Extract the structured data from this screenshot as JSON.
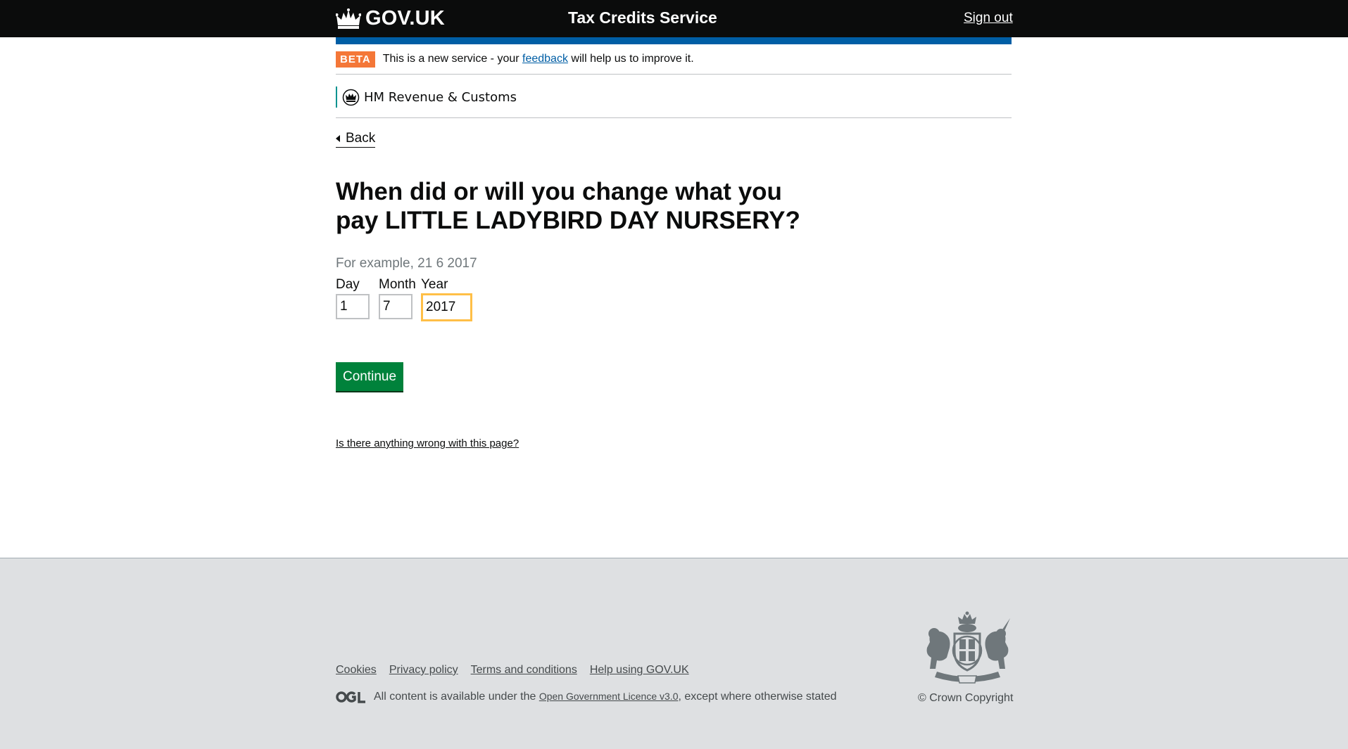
{
  "header": {
    "logo_text": "GOV.UK",
    "service_name": "Tax Credits Service",
    "sign_out": "Sign out"
  },
  "beta_banner": {
    "tag": "BETA",
    "text_before": "This is a new service - your ",
    "link": "feedback",
    "text_after": " will help us to improve it."
  },
  "organisation": {
    "name": "HM Revenue & Customs"
  },
  "back_link": "Back",
  "page": {
    "heading": "When did or will you change what you pay LITTLE LADYBIRD DAY NURSERY?",
    "hint": "For example, 21 6 2017",
    "date": {
      "day_label": "Day",
      "day_value": "1",
      "month_label": "Month",
      "month_value": "7",
      "year_label": "Year",
      "year_value": "2017"
    },
    "continue_button": "Continue",
    "report_link": "Is there anything wrong with this page?"
  },
  "footer": {
    "links": [
      "Cookies",
      "Privacy policy",
      "Terms and conditions",
      "Help using GOV.UK"
    ],
    "licence_before": "All content is available under the ",
    "licence_link": "Open Government Licence v3.0",
    "licence_after": ", except where otherwise stated",
    "copyright": "© Crown Copyright"
  },
  "colors": {
    "header_bg": "#0b0c0c",
    "blue_bar": "#005ea5",
    "beta_tag": "#f47738",
    "button": "#00823b",
    "focus": "#ffbf47",
    "footer_bg": "#dee0e2"
  },
  "icons": [
    "crown-icon",
    "hmrc-crest-icon",
    "back-arrow-icon",
    "ogl-logo-icon",
    "royal-arms-icon"
  ]
}
